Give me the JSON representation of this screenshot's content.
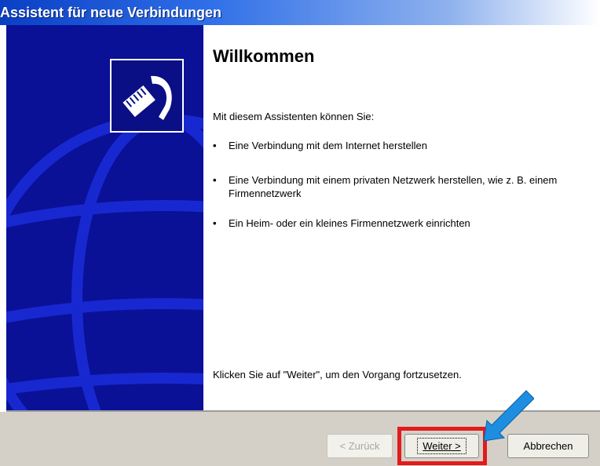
{
  "window": {
    "title": "Assistent für neue Verbindungen"
  },
  "content": {
    "heading": "Willkommen",
    "intro": "Mit diesem Assistenten können Sie:",
    "bullets": [
      "Eine Verbindung mit dem Internet herstellen",
      "Eine Verbindung mit einem privaten Netzwerk herstellen, wie z. B. einem Firmennetzwerk",
      "Ein Heim- oder ein kleines Firmennetzwerk einrichten"
    ],
    "closing": "Klicken Sie auf \"Weiter\", um den Vorgang fortzusetzen."
  },
  "footer": {
    "back_label": "< Zurück",
    "next_label": "Weiter >",
    "cancel_label": "Abbrechen"
  },
  "colors": {
    "side_panel": "#0a1196",
    "highlight": "#e21b1b",
    "arrow": "#1e8ee0"
  },
  "icons": [
    "network-cable-icon",
    "globe-graphic",
    "pointer-arrow-icon"
  ]
}
